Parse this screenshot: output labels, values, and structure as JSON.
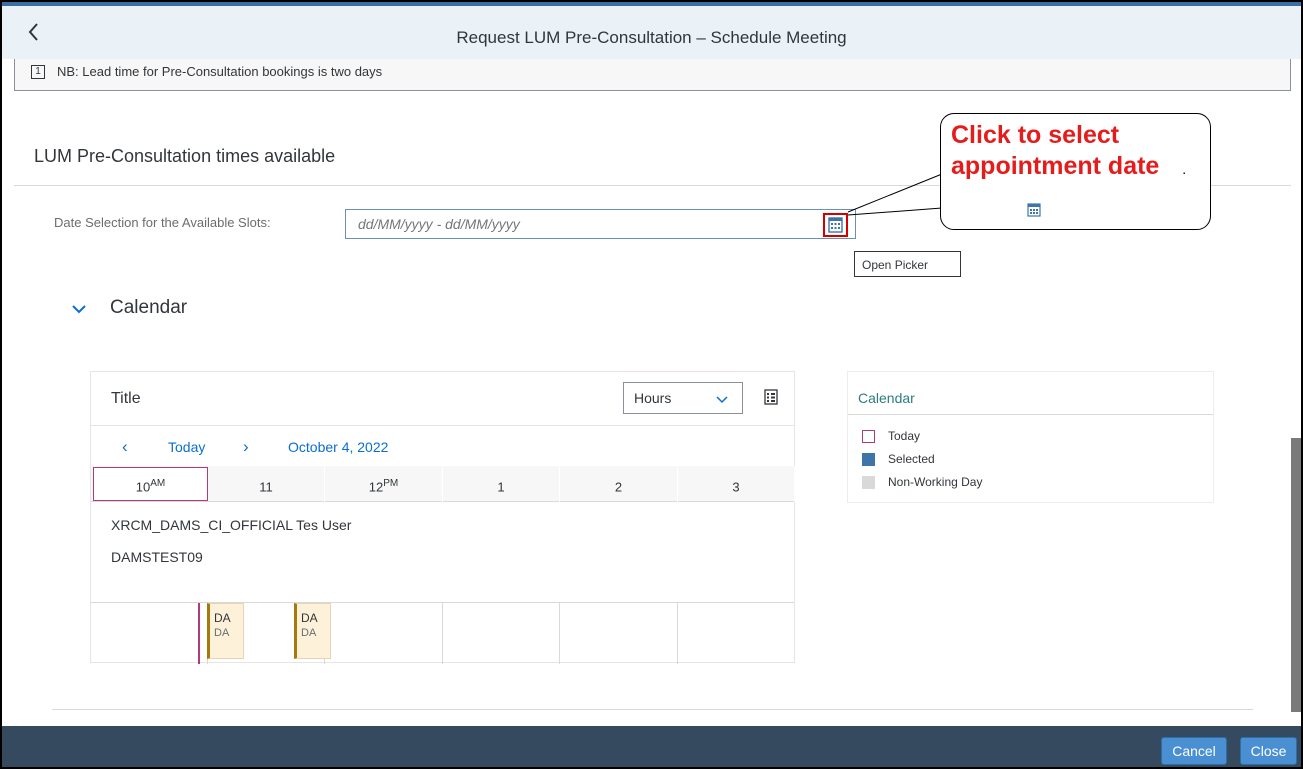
{
  "dialog": {
    "title": "Request LUM Pre-Consultation – Schedule Meeting",
    "note_icon": "1",
    "note": "NB: Lead time for Pre-Consultation bookings is two days"
  },
  "section": {
    "title": "LUM Pre-Consultation times available",
    "date_label": "Date Selection for the Available Slots:",
    "date_placeholder": "dd/MM/yyyy - dd/MM/yyyy",
    "picker_tooltip": "Open Picker"
  },
  "callout": {
    "text": "Click to select appointment date",
    "trailing": "."
  },
  "calendar_panel": {
    "heading": "Calendar",
    "title": "Title",
    "view": "Hours",
    "nav_today": "Today",
    "current_date": "October 4, 2022",
    "hours": [
      {
        "num": "10",
        "suffix": "AM"
      },
      {
        "num": "11",
        "suffix": ""
      },
      {
        "num": "12",
        "suffix": "PM"
      },
      {
        "num": "1",
        "suffix": ""
      },
      {
        "num": "2",
        "suffix": ""
      },
      {
        "num": "3",
        "suffix": ""
      }
    ],
    "row_name": "XRCM_DAMS_CI_OFFICIAL Tes User",
    "row_id": "DAMSTEST09",
    "appointments": [
      {
        "title": "DA",
        "text": "DA"
      },
      {
        "title": "DA",
        "text": "DA"
      }
    ]
  },
  "legend": {
    "title": "Calendar",
    "items": [
      {
        "label": "Today",
        "color": "#b03a7e"
      },
      {
        "label": "Selected",
        "color": "#3f74a8"
      },
      {
        "label": "Non-Working Day",
        "color": "#d9d9d9"
      }
    ]
  },
  "footer": {
    "cancel": "Cancel",
    "close": "Close"
  },
  "icons": [
    "chevron-left-icon",
    "info-icon",
    "calendar-icon",
    "chevron-down-icon",
    "legend-icon"
  ]
}
